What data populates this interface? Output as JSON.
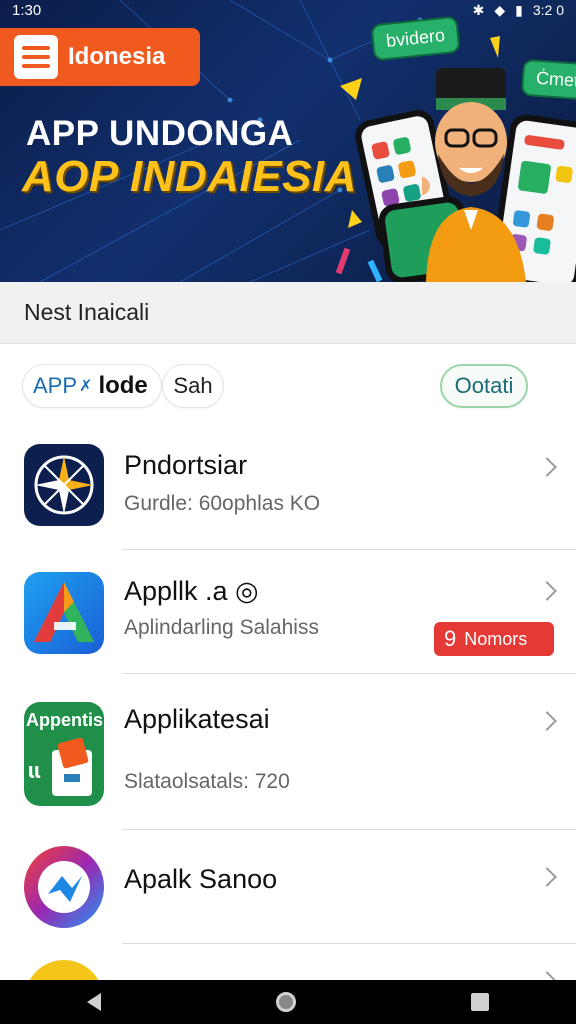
{
  "status_bar": {
    "time": "1:30",
    "right_time": "3:2 0"
  },
  "banner": {
    "logo_text": "Idonesia",
    "title_line1": "APP UNDONGA",
    "title_line2": "AOP INDAIESIA",
    "pill_left": "bvidero",
    "pill_right": "Ċmeti",
    "phone_center_text": "▢▢▢"
  },
  "section": {
    "title": "Nest Inaicali"
  },
  "filters": {
    "chip1_text": "APP",
    "chip1_icon": "✗",
    "chip1_bold": "lode",
    "chip2_text": "Sah",
    "chip3_text": "Ootati"
  },
  "list": [
    {
      "title": "Pndortsiar",
      "subtitle": "Gurdle: 60ophlas KO",
      "icon": "compass-icon"
    },
    {
      "title": "Appllk .a ◎",
      "subtitle": "Aplindarling Salahiss",
      "icon": "arrow-a-icon",
      "badge_number": "9",
      "badge_text": "Nomors"
    },
    {
      "title": "Applikatesai",
      "subtitle": "Slataolsatals: 720",
      "icon": "green-box-icon",
      "icon_label": "Appentis",
      "icon_glyph": "ɩɩ"
    },
    {
      "title": "Apalk Sanoo",
      "subtitle": "",
      "icon": "colorful-loop-icon"
    },
    {
      "title": "",
      "subtitle": "",
      "icon": "yellow-circle-icon"
    }
  ],
  "colors": {
    "accent_orange": "#f15a1e",
    "accent_yellow": "#ffc21a",
    "promo_red": "#e53935",
    "banner_navy": "#0b1d4a"
  }
}
